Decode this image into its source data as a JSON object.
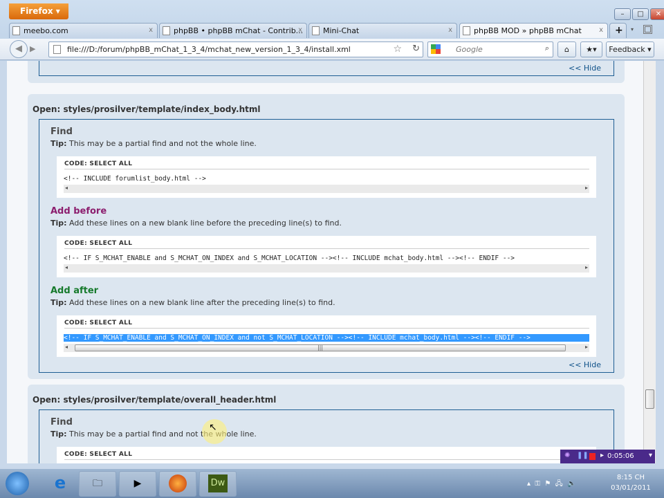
{
  "browser": {
    "menu_button": "Firefox ▾",
    "tabs": [
      {
        "title": "meebo.com",
        "active": false
      },
      {
        "title": "phpBB • phpBB mChat - Contrib...",
        "active": false
      },
      {
        "title": "Mini-Chat",
        "active": false
      },
      {
        "title": "phpBB MOD » phpBB mChat",
        "active": true
      }
    ],
    "url": "file:///D:/forum/phpBB_mChat_1_3_4/mchat_new_version_1_3_4/install.xml",
    "search_placeholder": "Google",
    "feedback": "Feedback ▾"
  },
  "content": {
    "hide_label": "<< Hide",
    "sections": [
      {
        "open": "Open: styles/prosilver/template/index_body.html",
        "steps": [
          {
            "title": "Find",
            "kind": "find",
            "tip_label": "Tip:",
            "tip": "This may be a partial find and not the whole line.",
            "code_label": "CODE:",
            "select_all": "SELECT ALL",
            "code": "<!-- INCLUDE forumlist_body.html -->"
          },
          {
            "title": "Add before",
            "kind": "before",
            "tip_label": "Tip:",
            "tip": "Add these lines on a new blank line before the preceding line(s) to find.",
            "code_label": "CODE:",
            "select_all": "SELECT ALL",
            "code": "<!-- IF S_MCHAT_ENABLE and S_MCHAT_ON_INDEX and S_MCHAT_LOCATION --><!-- INCLUDE mchat_body.html --><!-- ENDIF -->"
          },
          {
            "title": "Add after",
            "kind": "after",
            "tip_label": "Tip:",
            "tip": "Add these lines on a new blank line after the preceding line(s) to find.",
            "code_label": "CODE:",
            "select_all": "SELECT ALL",
            "code": "<!-- IF S_MCHAT_ENABLE and S_MCHAT_ON_INDEX and not S_MCHAT_LOCATION --><!-- INCLUDE mchat_body.html --><!-- ENDIF -->"
          }
        ]
      },
      {
        "open": "Open: styles/prosilver/template/overall_header.html",
        "steps": [
          {
            "title": "Find",
            "tip_label": "Tip:",
            "tip": "This may be a partial find and not the whole line.",
            "code_label": "CODE:",
            "select_all": "SELECT ALL"
          }
        ]
      }
    ]
  },
  "recorder": {
    "time": "0:05:06"
  },
  "taskbar": {
    "time": "8:15 CH",
    "date": "03/01/2011",
    "dw_label": "Dw"
  }
}
